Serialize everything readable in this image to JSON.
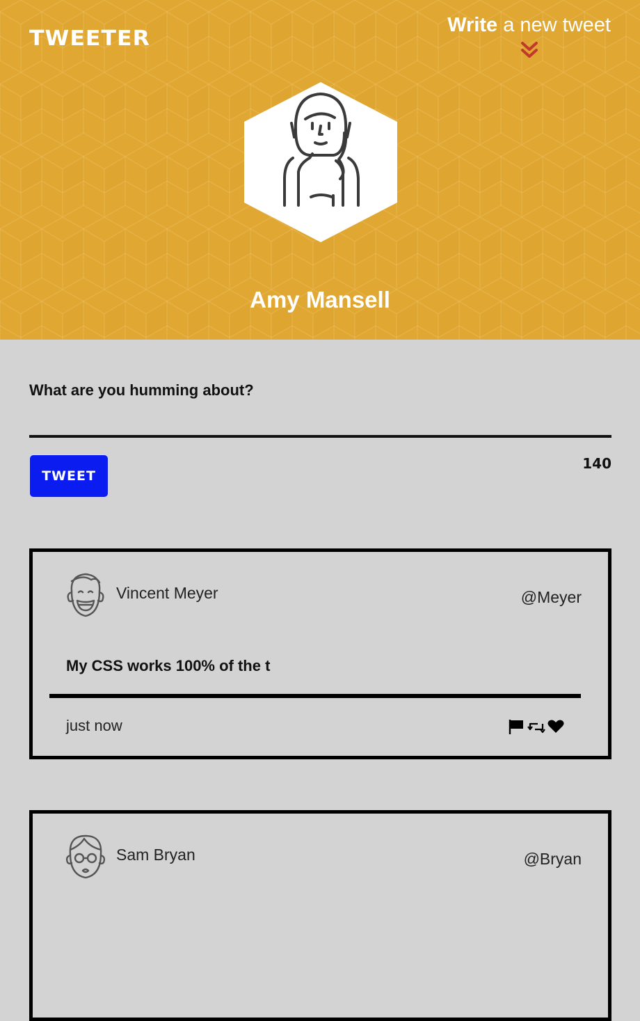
{
  "header": {
    "logo": "TWEETER",
    "write_strong": "Write",
    "write_rest": "a new tweet",
    "profile_name": "Amy Mansell",
    "colors": {
      "background": "#e0a832",
      "accent_chevron": "#c0392b"
    }
  },
  "compose": {
    "label": "What are you humming about?",
    "input_value": "",
    "button_label": "TWEET",
    "counter": "140",
    "colors": {
      "button": "#0a1cf0"
    }
  },
  "tweets": [
    {
      "name": "Vincent Meyer",
      "handle": "@Meyer",
      "text": "My CSS works 100% of the t",
      "time": "just now",
      "avatar": "smiling-man-icon"
    },
    {
      "name": "Sam Bryan",
      "handle": "@Bryan",
      "text": "",
      "time": "",
      "avatar": "man-with-glasses-icon"
    }
  ]
}
